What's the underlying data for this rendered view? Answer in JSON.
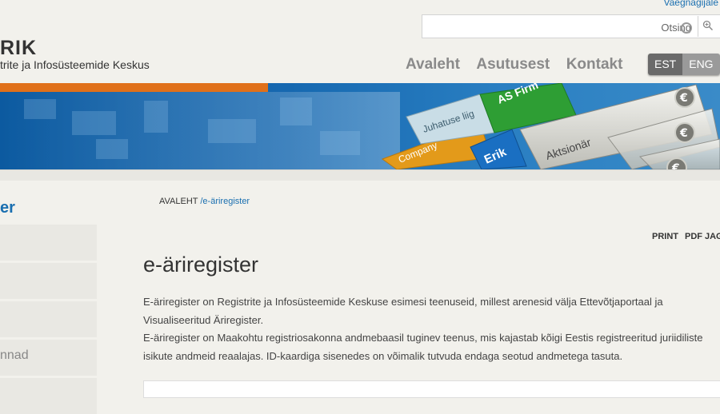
{
  "header": {
    "top_link": "Vaegnägijale",
    "logo_title": "RIK",
    "logo_subtitle": "trite ja Infosüsteemide Keskus",
    "search_placeholder": "Otsing"
  },
  "nav": {
    "items": [
      {
        "label": "Avaleht"
      },
      {
        "label": "Asutusest"
      },
      {
        "label": "Kontakt"
      }
    ]
  },
  "lang": {
    "est": "EST",
    "eng": "ENG"
  },
  "banner": {
    "label_juhatuse": "Juhatuse liig",
    "label_as": "AS Firm",
    "label_company": "Company",
    "label_erik": "Erik",
    "label_aktsionar": "Aktsionär",
    "euro_symbol": "€",
    "colors": {
      "orange_bar": "#e0701a",
      "blue_bg": "#1668b0",
      "green_card": "#2e9e34",
      "orange_card": "#e39a1a"
    }
  },
  "sidebar": {
    "title": "er",
    "visible_item_label": "nnad"
  },
  "breadcrumb": {
    "home": "AVALEHT",
    "current": "/e-äriregister"
  },
  "tools": {
    "print": "PRINT",
    "pdf": "PDF",
    "share": "JAG"
  },
  "main": {
    "title": "e-äriregister",
    "paragraphs": [
      "E-äriregister on Registrite ja Infosüsteemide Keskuse esimesi teenuseid, millest arenesid välja Ettevõtjaportaal ja Visualiseeritud Äriregister.",
      "E-äriregister on Maakohtu registriosakonna andmebaasil tuginev teenus, mis kajastab kõigi Eestis registreeritud juriidiliste isikute andmeid reaalajas. ID-kaardiga sisenedes on võimalik tutvuda endaga seotud andmetega tasuta."
    ]
  }
}
